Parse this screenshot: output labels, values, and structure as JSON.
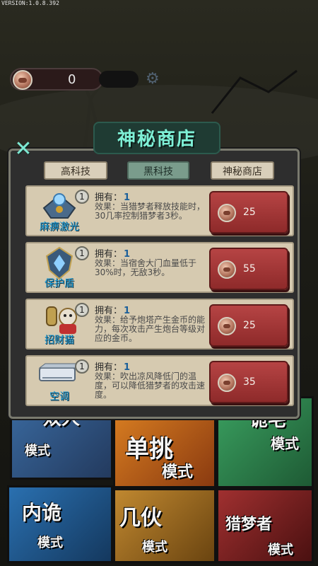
{
  "version": "VERSION:1.0.8.392",
  "currency": {
    "count": "0",
    "coin_icon": "coin-icon",
    "settings_icon": "gear-icon"
  },
  "shop": {
    "title": "神秘商店",
    "close_icon": "close-x-icon",
    "tabs": [
      {
        "label": "高科技",
        "active": false
      },
      {
        "label": "黑科技",
        "active": true
      },
      {
        "label": "神秘商店",
        "active": false
      }
    ],
    "owned_label": "拥有：",
    "items": [
      {
        "name": "麻痹激光",
        "level": "1",
        "owned": "1",
        "desc": "效果：当猎梦者释放技能时，30几率控制猎梦者3秒。",
        "price": "25",
        "icon": "laser-emitter-icon"
      },
      {
        "name": "保护盾",
        "level": "1",
        "owned": "1",
        "desc": "效果：当宿舍大门血量低于30%时，无敌3秒。",
        "price": "55",
        "icon": "shield-icon"
      },
      {
        "name": "招财猫",
        "level": "1",
        "owned": "1",
        "desc": "效果：给予炮塔产生金币的能力，每次攻击产生炮台等级对应的金币。",
        "price": "25",
        "icon": "lucky-cat-icon"
      },
      {
        "name": "空调",
        "level": "1",
        "owned": "1",
        "desc": "效果：吹出凉风降低门的温度，可以降低猎梦者的攻击速度。",
        "price": "35",
        "icon": "air-conditioner-icon"
      }
    ]
  },
  "modes": [
    {
      "title": "双人",
      "sub": "模式"
    },
    {
      "title": "单挑",
      "sub": "模式"
    },
    {
      "title": "诡宅",
      "sub": "模式"
    },
    {
      "title": "内诡",
      "sub": "模式"
    },
    {
      "title": "几伙",
      "sub": "模式"
    },
    {
      "title": "猎梦者",
      "sub": "模式"
    }
  ]
}
